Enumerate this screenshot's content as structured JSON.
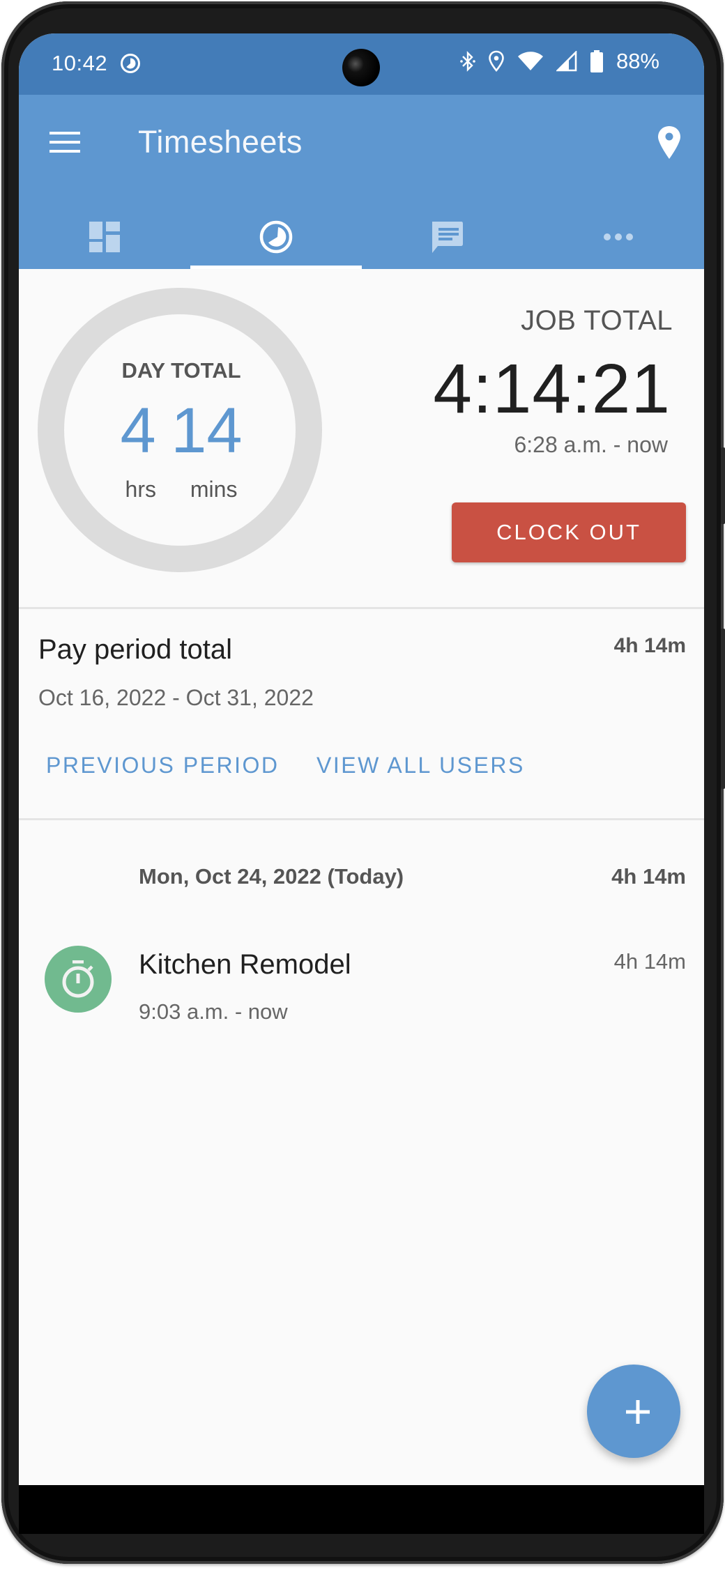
{
  "status_bar": {
    "time": "10:42",
    "battery_percent": "88%",
    "icons": [
      "data-saver-icon",
      "bluetooth-icon",
      "location-icon",
      "wifi-icon",
      "cell-signal-icon",
      "battery-icon"
    ]
  },
  "app_bar": {
    "title": "Timesheets",
    "left_icon": "menu-icon",
    "right_icon": "location-pin-icon"
  },
  "tabs": [
    {
      "name": "dashboard",
      "icon": "dashboard-icon",
      "active": false
    },
    {
      "name": "timesheets",
      "icon": "clock-icon",
      "active": true
    },
    {
      "name": "messages",
      "icon": "chat-icon",
      "active": false
    },
    {
      "name": "more",
      "icon": "more-icon",
      "active": false
    }
  ],
  "day_total": {
    "label": "DAY TOTAL",
    "hours": "4",
    "minutes": "14",
    "hours_unit": "hrs",
    "minutes_unit": "mins"
  },
  "job_total": {
    "label": "JOB TOTAL",
    "value": "4:14:21",
    "range": "6:28 a.m. - now",
    "clock_out_label": "CLOCK OUT"
  },
  "pay_period": {
    "title": "Pay period total",
    "total": "4h 14m",
    "range": "Oct 16, 2022 - Oct 31, 2022",
    "previous_label": "PREVIOUS PERIOD",
    "view_all_label": "VIEW ALL USERS"
  },
  "days": [
    {
      "date": "Mon, Oct 24, 2022 (Today)",
      "total": "4h 14m",
      "entries": [
        {
          "title": "Kitchen Remodel",
          "range": "9:03 a.m. - now",
          "total": "4h 14m",
          "icon": "stopwatch-icon"
        }
      ]
    }
  ],
  "fab": {
    "icon": "plus-icon"
  },
  "colors": {
    "status_bar": "#437cb8",
    "primary": "#5e97d0",
    "clock_out": "#c95143",
    "entry_icon": "#71ba8f",
    "background": "#fafafa"
  }
}
